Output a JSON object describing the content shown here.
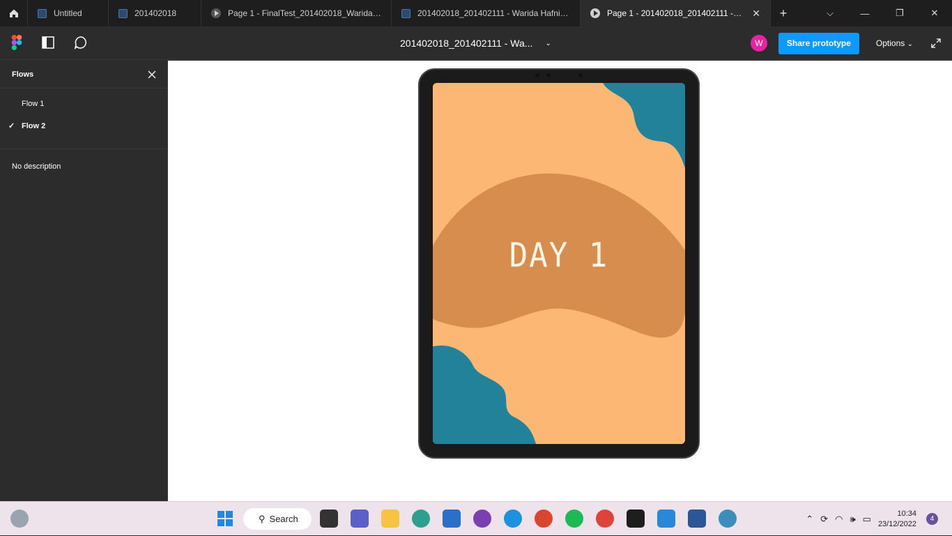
{
  "tabs": [
    {
      "label": "Untitled",
      "type": "file"
    },
    {
      "label": "201402018",
      "type": "file"
    },
    {
      "label": "Page 1 - FinalTest_201402018_Warida Hafni",
      "type": "prototype"
    },
    {
      "label": "201402018_201402111 - Warida Hafni Har",
      "type": "file"
    },
    {
      "label": "Page 1 - 201402018_201402111 - Warida",
      "type": "prototype",
      "active": true
    }
  ],
  "toolbar": {
    "doc_title": "201402018_201402111 - Wa...",
    "avatar_initial": "W",
    "share_label": "Share prototype",
    "options_label": "Options"
  },
  "sidebar": {
    "title": "Flows",
    "flows": [
      {
        "label": "Flow 1",
        "selected": false
      },
      {
        "label": "Flow 2",
        "selected": true
      }
    ],
    "description": "No description"
  },
  "frame": {
    "title": "DAY 1",
    "colors": {
      "background": "#fdb775",
      "blob": "#d68d4d",
      "teal": "#21829a"
    }
  },
  "taskbar": {
    "search_label": "Search",
    "time": "10:34",
    "date": "23/12/2022",
    "notifications": "4"
  }
}
